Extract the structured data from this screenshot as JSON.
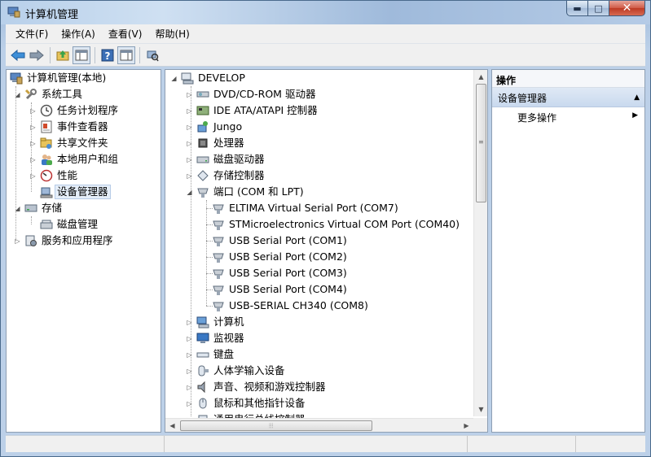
{
  "window": {
    "title": "计算机管理",
    "controls": {
      "minimize": "▬",
      "maximize": "□",
      "close": "✕"
    }
  },
  "menu": [
    "文件(F)",
    "操作(A)",
    "查看(V)",
    "帮助(H)"
  ],
  "toolbar": {
    "icons": [
      "back-arrow-icon",
      "forward-arrow-icon",
      "up-folder-icon",
      "show-hide-tree-icon",
      "help-icon",
      "properties-icon",
      "device-scan-icon"
    ]
  },
  "left_tree": [
    {
      "label": "计算机管理(本地)",
      "icon": "computer-management-icon",
      "level": 0,
      "expander": ""
    },
    {
      "label": "系统工具",
      "icon": "tools-icon",
      "level": 1,
      "expander": "◢"
    },
    {
      "label": "任务计划程序",
      "icon": "clock-icon",
      "level": 2,
      "expander": "▷"
    },
    {
      "label": "事件查看器",
      "icon": "event-viewer-icon",
      "level": 2,
      "expander": "▷"
    },
    {
      "label": "共享文件夹",
      "icon": "shared-folder-icon",
      "level": 2,
      "expander": "▷"
    },
    {
      "label": "本地用户和组",
      "icon": "users-icon",
      "level": 2,
      "expander": "▷"
    },
    {
      "label": "性能",
      "icon": "performance-icon",
      "level": 2,
      "expander": "▷"
    },
    {
      "label": "设备管理器",
      "icon": "device-manager-icon",
      "level": 2,
      "expander": "",
      "selected": true
    },
    {
      "label": "存储",
      "icon": "storage-icon",
      "level": 1,
      "expander": "◢"
    },
    {
      "label": "磁盘管理",
      "icon": "disk-management-icon",
      "level": 2,
      "expander": ""
    },
    {
      "label": "服务和应用程序",
      "icon": "services-icon",
      "level": 1,
      "expander": "▷"
    }
  ],
  "device_tree": {
    "root": "DEVELOP",
    "items": [
      {
        "label": "DVD/CD-ROM 驱动器",
        "icon": "dvd-drive-icon",
        "level": 1,
        "expander": "▷"
      },
      {
        "label": "IDE ATA/ATAPI 控制器",
        "icon": "ide-controller-icon",
        "level": 1,
        "expander": "▷"
      },
      {
        "label": "Jungo",
        "icon": "jungo-icon",
        "level": 1,
        "expander": "▷"
      },
      {
        "label": "处理器",
        "icon": "processor-icon",
        "level": 1,
        "expander": "▷"
      },
      {
        "label": "磁盘驱动器",
        "icon": "disk-drive-icon",
        "level": 1,
        "expander": "▷"
      },
      {
        "label": "存储控制器",
        "icon": "storage-controller-icon",
        "level": 1,
        "expander": "▷"
      },
      {
        "label": "端口 (COM 和 LPT)",
        "icon": "port-icon",
        "level": 1,
        "expander": "◢"
      },
      {
        "label": "ELTIMA Virtual Serial Port (COM7)",
        "icon": "port-icon",
        "level": 2,
        "expander": ""
      },
      {
        "label": "STMicroelectronics Virtual COM Port (COM40)",
        "icon": "port-icon",
        "level": 2,
        "expander": ""
      },
      {
        "label": "USB Serial Port (COM1)",
        "icon": "port-icon",
        "level": 2,
        "expander": ""
      },
      {
        "label": "USB Serial Port (COM2)",
        "icon": "port-icon",
        "level": 2,
        "expander": ""
      },
      {
        "label": "USB Serial Port (COM3)",
        "icon": "port-icon",
        "level": 2,
        "expander": ""
      },
      {
        "label": "USB Serial Port (COM4)",
        "icon": "port-icon",
        "level": 2,
        "expander": ""
      },
      {
        "label": "USB-SERIAL CH340 (COM8)",
        "icon": "port-icon",
        "level": 2,
        "expander": ""
      },
      {
        "label": "计算机",
        "icon": "computer-icon",
        "level": 1,
        "expander": "▷"
      },
      {
        "label": "监视器",
        "icon": "monitor-icon",
        "level": 1,
        "expander": "▷"
      },
      {
        "label": "键盘",
        "icon": "keyboard-icon",
        "level": 1,
        "expander": "▷"
      },
      {
        "label": "人体学输入设备",
        "icon": "hid-icon",
        "level": 1,
        "expander": "▷"
      },
      {
        "label": "声音、视频和游戏控制器",
        "icon": "sound-icon",
        "level": 1,
        "expander": "▷"
      },
      {
        "label": "鼠标和其他指针设备",
        "icon": "mouse-icon",
        "level": 1,
        "expander": "▷"
      },
      {
        "label": "通用串行总线控制器",
        "icon": "usb-icon",
        "level": 1,
        "expander": "▷"
      }
    ]
  },
  "actions": {
    "header": "操作",
    "section": "设备管理器",
    "section_toggle": "▲",
    "more": "更多操作",
    "more_arrow": "▶"
  },
  "scrollbars": {
    "up": "▲",
    "down": "▼",
    "left": "◀",
    "right": "▶",
    "grip_v": "≡",
    "grip_h": "⦙⦙⦙"
  }
}
